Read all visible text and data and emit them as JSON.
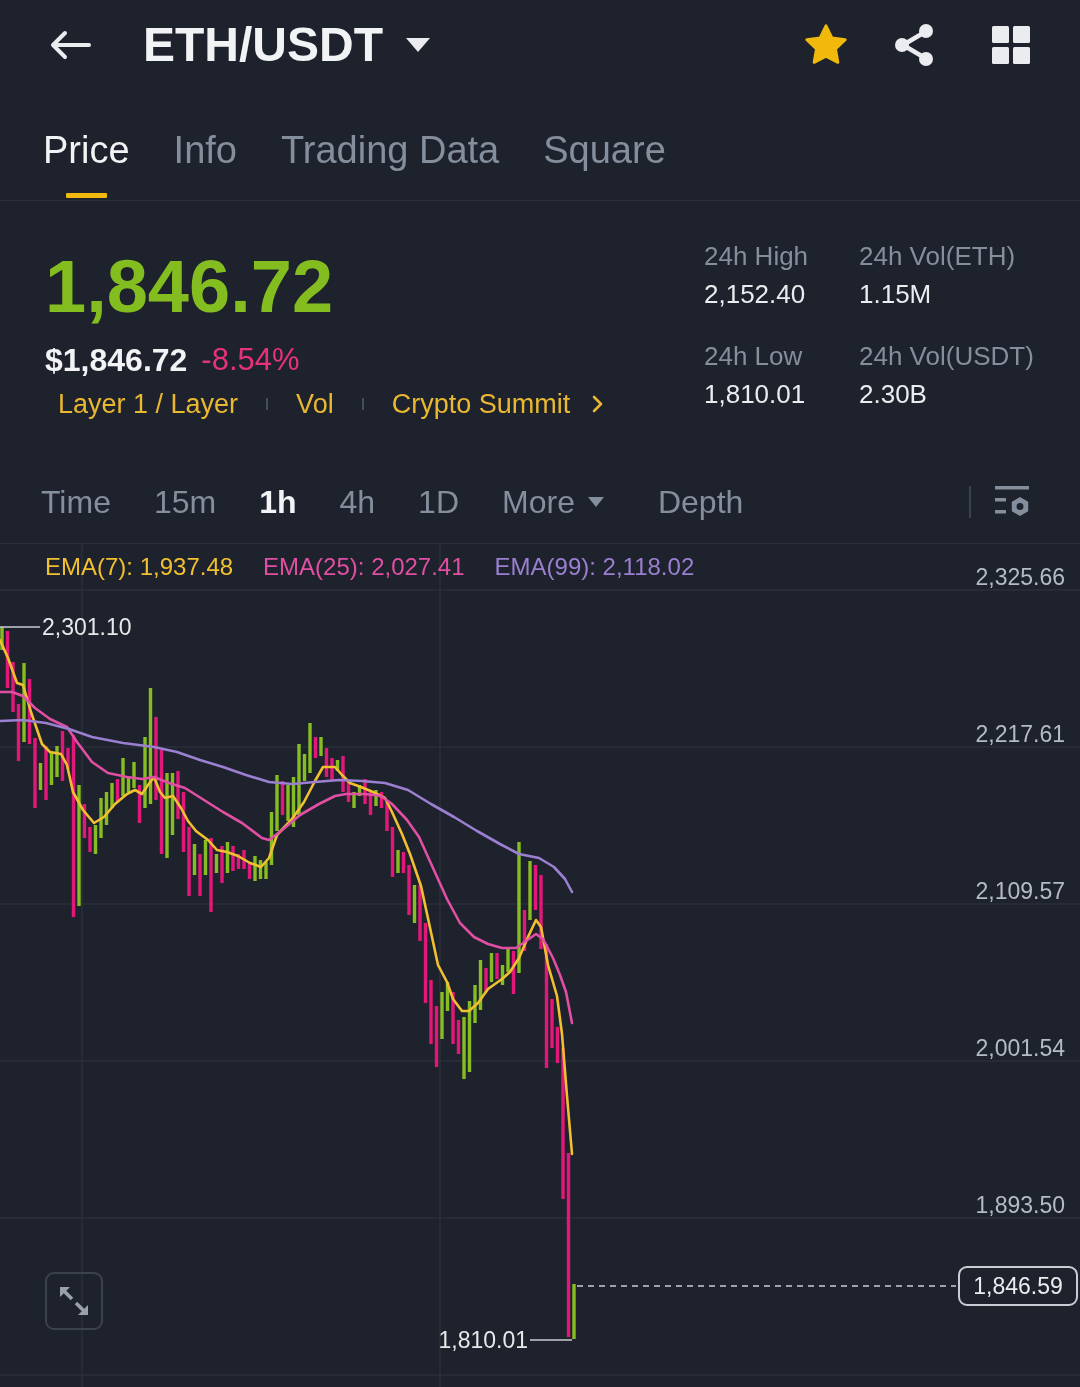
{
  "header": {
    "title": "ETH/USDT",
    "favorite": true
  },
  "tabs": [
    {
      "label": "Price",
      "selected": true
    },
    {
      "label": "Info",
      "selected": false
    },
    {
      "label": "Trading Data",
      "selected": false
    },
    {
      "label": "Square",
      "selected": false
    }
  ],
  "ticker": {
    "last_price": "1,846.72",
    "usd_price": "$1,846.72",
    "change": "-8.54%",
    "tags": [
      "Layer 1 / Layer",
      "Vol",
      "Crypto Summit"
    ]
  },
  "stats": [
    {
      "label": "24h High",
      "value": "2,152.40"
    },
    {
      "label": "24h Vol(ETH)",
      "value": "1.15M"
    },
    {
      "label": "24h Low",
      "value": "1,810.01"
    },
    {
      "label": "24h Vol(USDT)",
      "value": "2.30B"
    }
  ],
  "intervals": [
    {
      "label": "Time",
      "kind": "option",
      "selected": false
    },
    {
      "label": "15m",
      "kind": "option",
      "selected": false
    },
    {
      "label": "1h",
      "kind": "option",
      "selected": true
    },
    {
      "label": "4h",
      "kind": "option",
      "selected": false
    },
    {
      "label": "1D",
      "kind": "option",
      "selected": false
    },
    {
      "label": "More",
      "kind": "menu",
      "selected": false
    },
    {
      "label": "Depth",
      "kind": "option",
      "selected": false
    }
  ],
  "chart": {
    "indicators": [
      {
        "label": "EMA(7): 1,937.48",
        "color": "#f0c030"
      },
      {
        "label": "EMA(25): 2,027.41",
        "color": "#e04fa3"
      },
      {
        "label": "EMA(99): 2,118.02",
        "color": "#9b7fd0"
      }
    ],
    "price_axis": [
      "2,325.66",
      "2,217.61",
      "2,109.57",
      "2,001.54",
      "1,893.50"
    ],
    "high_label": "2,301.10",
    "low_label": "1,810.01",
    "last_price": "1,846.59"
  }
}
